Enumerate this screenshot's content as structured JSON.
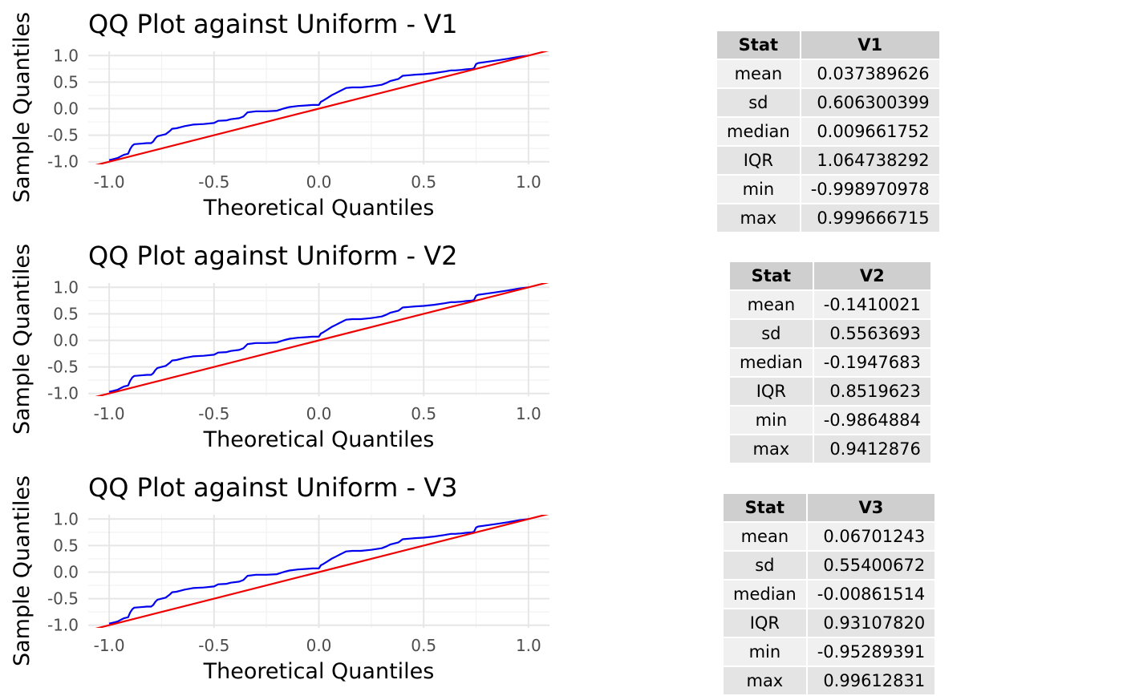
{
  "chart_data": [
    {
      "type": "line",
      "title": "QQ Plot against Uniform -  V1",
      "xlabel": "Theoretical Quantiles",
      "ylabel": "Sample Quantiles",
      "xlim": [
        -1.1,
        1.1
      ],
      "ylim": [
        -1.05,
        1.08
      ],
      "xticks": [
        "-1.0",
        "-0.5",
        "0.0",
        "0.5",
        "1.0"
      ],
      "yticks": [
        "-1.0",
        "-0.5",
        "0.0",
        "0.5",
        "1.0"
      ],
      "grid": true,
      "series": [
        {
          "color": "#0000ee",
          "x": [
            -1.0,
            -0.98,
            -0.96,
            -0.95,
            -0.94,
            -0.93,
            -0.92,
            -0.91,
            -0.9,
            -0.89,
            -0.88,
            -0.85,
            -0.82,
            -0.8,
            -0.79,
            -0.78,
            -0.77,
            -0.75,
            -0.73,
            -0.71,
            -0.7,
            -0.68,
            -0.66,
            -0.64,
            -0.6,
            -0.55,
            -0.5,
            -0.48,
            -0.44,
            -0.42,
            -0.38,
            -0.36,
            -0.34,
            -0.3,
            -0.25,
            -0.2,
            -0.17,
            -0.14,
            -0.1,
            -0.06,
            -0.03,
            0.0,
            0.01,
            0.02,
            0.04,
            0.06,
            0.08,
            0.1,
            0.13,
            0.16,
            0.2,
            0.25,
            0.3,
            0.32,
            0.34,
            0.38,
            0.4,
            0.43,
            0.46,
            0.5,
            0.55,
            0.6,
            0.63,
            0.65,
            0.68,
            0.7,
            0.73,
            0.74,
            0.75,
            0.76,
            0.8,
            0.85,
            0.9,
            0.93,
            0.96,
            1.0
          ],
          "y": [
            -0.97,
            -0.95,
            -0.93,
            -0.91,
            -0.89,
            -0.87,
            -0.86,
            -0.85,
            -0.76,
            -0.7,
            -0.67,
            -0.66,
            -0.65,
            -0.65,
            -0.62,
            -0.56,
            -0.52,
            -0.5,
            -0.48,
            -0.42,
            -0.38,
            -0.37,
            -0.35,
            -0.33,
            -0.3,
            -0.29,
            -0.27,
            -0.23,
            -0.22,
            -0.2,
            -0.18,
            -0.15,
            -0.07,
            -0.05,
            -0.05,
            -0.04,
            0.0,
            0.03,
            0.05,
            0.06,
            0.07,
            0.07,
            0.13,
            0.15,
            0.2,
            0.25,
            0.29,
            0.33,
            0.39,
            0.4,
            0.4,
            0.42,
            0.45,
            0.48,
            0.52,
            0.56,
            0.62,
            0.63,
            0.64,
            0.65,
            0.67,
            0.7,
            0.72,
            0.72,
            0.73,
            0.74,
            0.75,
            0.76,
            0.84,
            0.86,
            0.88,
            0.91,
            0.94,
            0.96,
            0.98,
            1.0
          ]
        },
        {
          "color": "#ee0000",
          "x": [
            -1.1,
            1.1
          ],
          "y": [
            -1.1,
            1.1
          ]
        }
      ]
    },
    {
      "type": "line",
      "title": "QQ Plot against Uniform -  V2",
      "xlabel": "Theoretical Quantiles",
      "ylabel": "Sample Quantiles",
      "xlim": [
        -1.1,
        1.1
      ],
      "ylim": [
        -1.05,
        1.08
      ],
      "xticks": [
        "-1.0",
        "-0.5",
        "0.0",
        "0.5",
        "1.0"
      ],
      "yticks": [
        "-1.0",
        "-0.5",
        "0.0",
        "0.5",
        "1.0"
      ],
      "grid": true,
      "series": [
        {
          "color": "#0000ee",
          "x": [
            -1.0,
            -0.98,
            -0.96,
            -0.95,
            -0.94,
            -0.93,
            -0.92,
            -0.91,
            -0.9,
            -0.89,
            -0.88,
            -0.85,
            -0.82,
            -0.8,
            -0.79,
            -0.78,
            -0.77,
            -0.75,
            -0.73,
            -0.71,
            -0.7,
            -0.68,
            -0.66,
            -0.64,
            -0.6,
            -0.55,
            -0.5,
            -0.48,
            -0.44,
            -0.42,
            -0.38,
            -0.36,
            -0.34,
            -0.3,
            -0.25,
            -0.2,
            -0.17,
            -0.14,
            -0.1,
            -0.06,
            -0.03,
            0.0,
            0.01,
            0.02,
            0.04,
            0.06,
            0.08,
            0.1,
            0.13,
            0.16,
            0.2,
            0.25,
            0.3,
            0.32,
            0.34,
            0.38,
            0.4,
            0.43,
            0.46,
            0.5,
            0.55,
            0.6,
            0.63,
            0.65,
            0.68,
            0.7,
            0.73,
            0.74,
            0.75,
            0.76,
            0.8,
            0.85,
            0.9,
            0.93,
            0.96,
            1.0
          ],
          "y": [
            -0.97,
            -0.95,
            -0.93,
            -0.91,
            -0.89,
            -0.87,
            -0.86,
            -0.85,
            -0.76,
            -0.7,
            -0.67,
            -0.66,
            -0.65,
            -0.65,
            -0.62,
            -0.56,
            -0.52,
            -0.5,
            -0.48,
            -0.42,
            -0.38,
            -0.37,
            -0.35,
            -0.33,
            -0.3,
            -0.29,
            -0.27,
            -0.23,
            -0.22,
            -0.2,
            -0.18,
            -0.15,
            -0.07,
            -0.05,
            -0.05,
            -0.04,
            0.0,
            0.03,
            0.05,
            0.06,
            0.07,
            0.07,
            0.13,
            0.15,
            0.2,
            0.25,
            0.29,
            0.33,
            0.39,
            0.4,
            0.4,
            0.42,
            0.45,
            0.48,
            0.52,
            0.56,
            0.62,
            0.63,
            0.64,
            0.65,
            0.67,
            0.7,
            0.72,
            0.72,
            0.73,
            0.74,
            0.75,
            0.76,
            0.84,
            0.86,
            0.88,
            0.91,
            0.94,
            0.96,
            0.98,
            1.0
          ]
        },
        {
          "color": "#ee0000",
          "x": [
            -1.1,
            1.1
          ],
          "y": [
            -1.1,
            1.1
          ]
        }
      ]
    },
    {
      "type": "line",
      "title": "QQ Plot against Uniform -  V3",
      "xlabel": "Theoretical Quantiles",
      "ylabel": "Sample Quantiles",
      "xlim": [
        -1.1,
        1.1
      ],
      "ylim": [
        -1.05,
        1.08
      ],
      "xticks": [
        "-1.0",
        "-0.5",
        "0.0",
        "0.5",
        "1.0"
      ],
      "yticks": [
        "-1.0",
        "-0.5",
        "0.0",
        "0.5",
        "1.0"
      ],
      "grid": true,
      "series": [
        {
          "color": "#0000ee",
          "x": [
            -1.0,
            -0.98,
            -0.96,
            -0.95,
            -0.94,
            -0.93,
            -0.92,
            -0.91,
            -0.9,
            -0.89,
            -0.88,
            -0.85,
            -0.82,
            -0.8,
            -0.79,
            -0.78,
            -0.77,
            -0.75,
            -0.73,
            -0.71,
            -0.7,
            -0.68,
            -0.66,
            -0.64,
            -0.6,
            -0.55,
            -0.5,
            -0.48,
            -0.44,
            -0.42,
            -0.38,
            -0.36,
            -0.34,
            -0.3,
            -0.25,
            -0.2,
            -0.17,
            -0.14,
            -0.1,
            -0.06,
            -0.03,
            0.0,
            0.01,
            0.02,
            0.04,
            0.06,
            0.08,
            0.1,
            0.13,
            0.16,
            0.2,
            0.25,
            0.3,
            0.32,
            0.34,
            0.38,
            0.4,
            0.43,
            0.46,
            0.5,
            0.55,
            0.6,
            0.63,
            0.65,
            0.68,
            0.7,
            0.73,
            0.74,
            0.75,
            0.76,
            0.8,
            0.85,
            0.9,
            0.93,
            0.96,
            1.0
          ],
          "y": [
            -0.97,
            -0.95,
            -0.93,
            -0.91,
            -0.89,
            -0.87,
            -0.86,
            -0.85,
            -0.76,
            -0.7,
            -0.67,
            -0.66,
            -0.65,
            -0.65,
            -0.62,
            -0.56,
            -0.52,
            -0.5,
            -0.48,
            -0.42,
            -0.38,
            -0.37,
            -0.35,
            -0.33,
            -0.3,
            -0.29,
            -0.27,
            -0.23,
            -0.22,
            -0.2,
            -0.18,
            -0.15,
            -0.07,
            -0.05,
            -0.05,
            -0.04,
            0.0,
            0.03,
            0.05,
            0.06,
            0.07,
            0.07,
            0.13,
            0.15,
            0.2,
            0.25,
            0.29,
            0.33,
            0.39,
            0.4,
            0.4,
            0.42,
            0.45,
            0.48,
            0.52,
            0.56,
            0.62,
            0.63,
            0.64,
            0.65,
            0.67,
            0.7,
            0.72,
            0.72,
            0.73,
            0.74,
            0.75,
            0.76,
            0.84,
            0.86,
            0.88,
            0.91,
            0.94,
            0.96,
            0.98,
            1.0
          ]
        },
        {
          "color": "#ee0000",
          "x": [
            -1.1,
            1.1
          ],
          "y": [
            -1.1,
            1.1
          ]
        }
      ]
    },
    {
      "type": "table",
      "columns": [
        "Stat",
        "V1"
      ],
      "rows": [
        [
          "mean",
          "0.037389626"
        ],
        [
          "sd",
          "0.606300399"
        ],
        [
          "median",
          "0.009661752"
        ],
        [
          "IQR",
          "1.064738292"
        ],
        [
          "min",
          "-0.998970978"
        ],
        [
          "max",
          "0.999666715"
        ]
      ]
    },
    {
      "type": "table",
      "columns": [
        "Stat",
        "V2"
      ],
      "rows": [
        [
          "mean",
          "-0.1410021"
        ],
        [
          "sd",
          "0.5563693"
        ],
        [
          "median",
          "-0.1947683"
        ],
        [
          "IQR",
          "0.8519623"
        ],
        [
          "min",
          "-0.9864884"
        ],
        [
          "max",
          "0.9412876"
        ]
      ]
    },
    {
      "type": "table",
      "columns": [
        "Stat",
        "V3"
      ],
      "rows": [
        [
          "mean",
          "0.06701243"
        ],
        [
          "sd",
          "0.55400672"
        ],
        [
          "median",
          "-0.00861514"
        ],
        [
          "IQR",
          "0.93107820"
        ],
        [
          "min",
          "-0.95289391"
        ],
        [
          "max",
          "0.99612831"
        ]
      ]
    }
  ]
}
